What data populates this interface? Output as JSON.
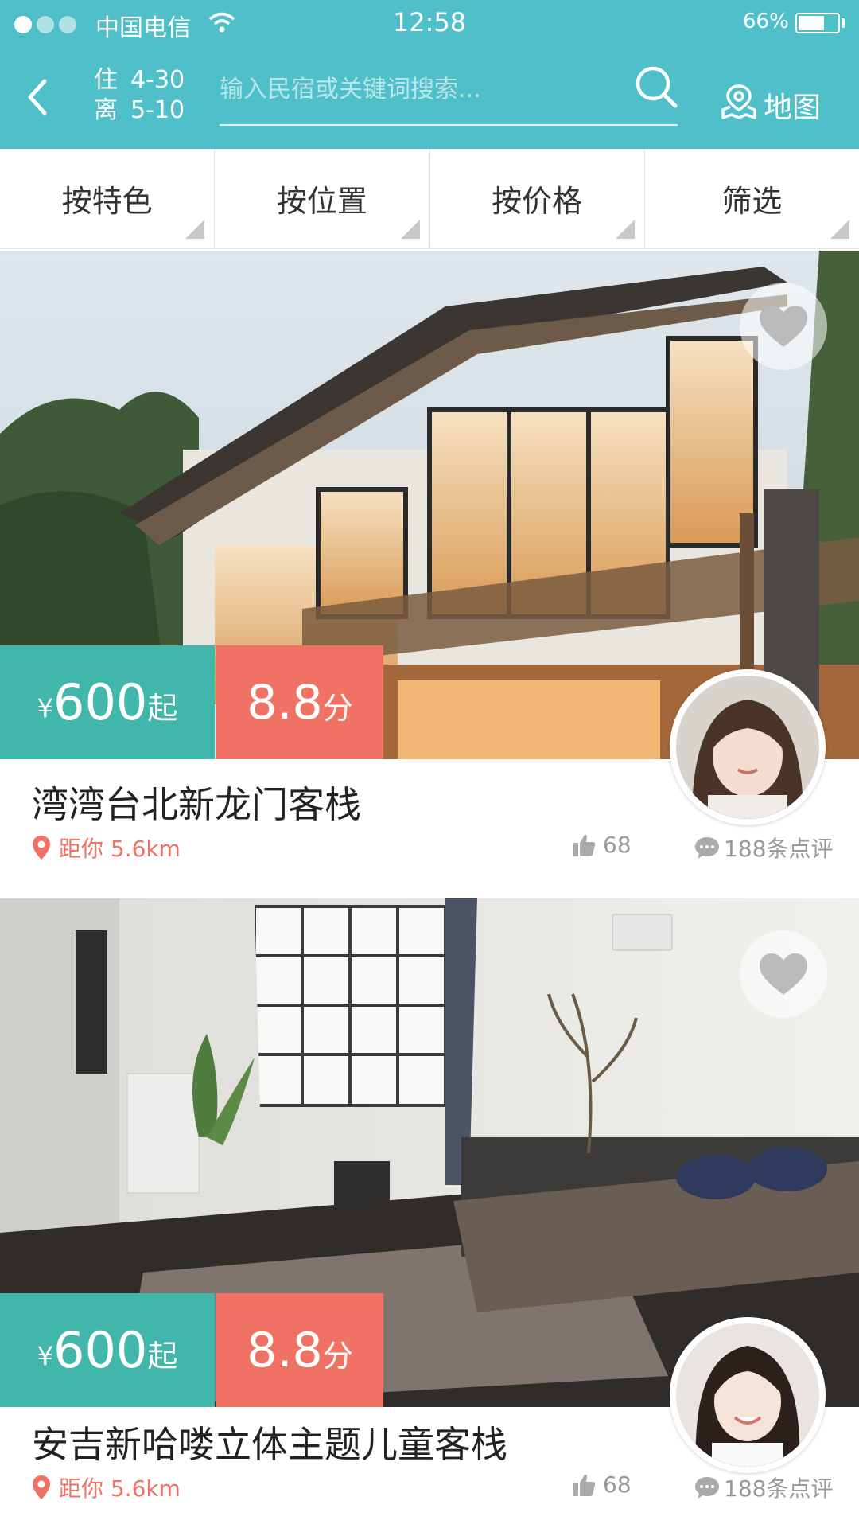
{
  "status_bar": {
    "carrier": "中国电信",
    "time": "12:58",
    "battery": "66%",
    "battery_level": 0.66
  },
  "header": {
    "checkin_label": "住",
    "checkin_date": "4-30",
    "checkout_label": "离",
    "checkout_date": "5-10",
    "search_placeholder": "输入民宿或关键词搜索...",
    "map_label": "地图",
    "icons": [
      "back-arrow-icon",
      "search-icon",
      "map-pin-icon"
    ]
  },
  "filters": [
    {
      "label": "按特色"
    },
    {
      "label": "按位置"
    },
    {
      "label": "按价格"
    },
    {
      "label": "筛选"
    }
  ],
  "listings": [
    {
      "currency": "¥",
      "price": "600",
      "price_suffix": "起",
      "score": "8.8",
      "score_suffix": "分",
      "name": "湾湾台北新龙门客栈",
      "distance": "距你 5.6km",
      "likes": "68",
      "reviews": "188条点评"
    },
    {
      "currency": "¥",
      "price": "600",
      "price_suffix": "起",
      "score": "8.8",
      "score_suffix": "分",
      "name": "安吉新哈喽立体主题儿童客栈",
      "distance": "距你 5.6km",
      "likes": "68",
      "reviews": "188条点评"
    }
  ],
  "colors": {
    "header_teal": "#4fc0c9",
    "price_teal": "#41b6aa",
    "score_coral": "#f07264"
  }
}
